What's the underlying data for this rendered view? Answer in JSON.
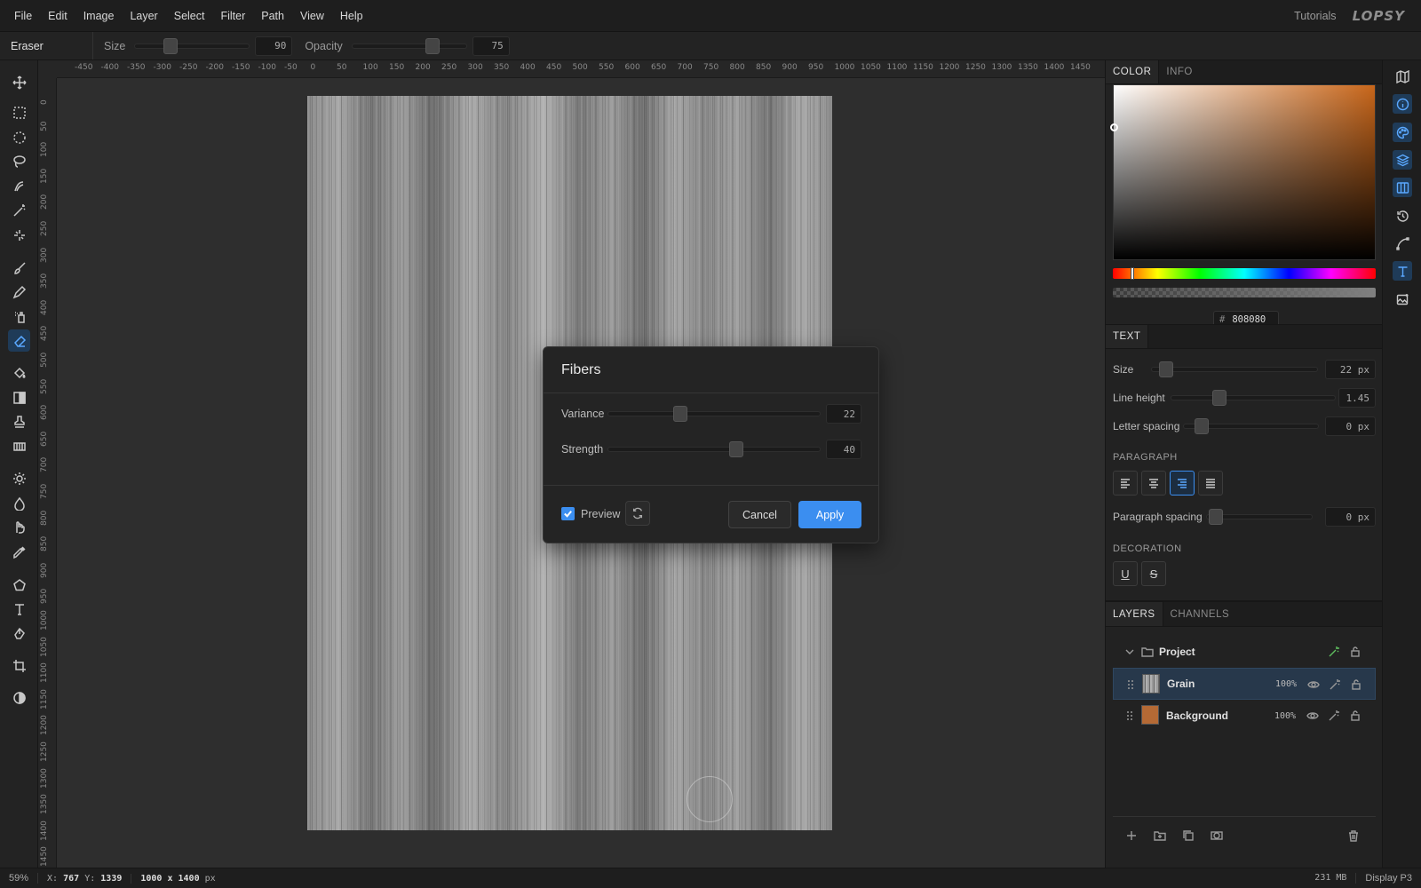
{
  "menu": {
    "items": [
      "File",
      "Edit",
      "Image",
      "Layer",
      "Select",
      "Filter",
      "Path",
      "View",
      "Help"
    ],
    "tutorials": "Tutorials",
    "logo": "LOPSY"
  },
  "options": {
    "tool": "Eraser",
    "size_label": "Size",
    "size_value": "90",
    "opacity_label": "Opacity",
    "opacity_value": "75"
  },
  "ruler": {
    "top": [
      "-450",
      "-400",
      "-350",
      "-300",
      "-250",
      "-200",
      "-150",
      "-100",
      "-50",
      "0",
      "50",
      "100",
      "150",
      "200",
      "250",
      "300",
      "350",
      "400",
      "450",
      "500",
      "550",
      "600",
      "650",
      "700",
      "750",
      "800",
      "850",
      "900",
      "950",
      "1000",
      "1050",
      "1100",
      "1150",
      "1200",
      "1250",
      "1300",
      "1350",
      "1400",
      "1450"
    ],
    "left": [
      "0",
      "50",
      "100",
      "150",
      "200",
      "250",
      "300",
      "350",
      "400",
      "450",
      "500",
      "550",
      "600",
      "650",
      "700",
      "750",
      "800",
      "850",
      "900",
      "950",
      "1000",
      "1050",
      "1100",
      "1150",
      "1200",
      "1250",
      "1300",
      "1350",
      "1400",
      "1450"
    ]
  },
  "dialog": {
    "title": "Fibers",
    "variance_label": "Variance",
    "variance_value": "22",
    "strength_label": "Strength",
    "strength_value": "40",
    "preview_label": "Preview",
    "preview_checked": true,
    "cancel": "Cancel",
    "apply": "Apply"
  },
  "color_panel": {
    "tabs": [
      "COLOR",
      "INFO"
    ],
    "hex_prefix": "#",
    "hex": "808080",
    "base_hue": "#c8661a"
  },
  "text_panel": {
    "tab": "TEXT",
    "size_label": "Size",
    "size_value": "22 px",
    "line_height_label": "Line height",
    "line_height_value": "1.45",
    "letter_spacing_label": "Letter spacing",
    "letter_spacing_value": "0 px",
    "paragraph_heading": "PARAGRAPH",
    "paragraph_spacing_label": "Paragraph spacing",
    "paragraph_spacing_value": "0 px",
    "decoration_heading": "DECORATION",
    "underline_glyph": "U",
    "strike_glyph": "S"
  },
  "layers_panel": {
    "tabs": [
      "LAYERS",
      "CHANNELS"
    ],
    "group": "Project",
    "layers": [
      {
        "name": "Grain",
        "opacity": "100%",
        "selected": true
      },
      {
        "name": "Background",
        "opacity": "100%",
        "selected": false
      }
    ]
  },
  "status": {
    "zoom": "59%",
    "x_label": "X:",
    "x": "767",
    "y_label": "Y:",
    "y": "1339",
    "size": "1000 x 1400",
    "unit": "px",
    "memory": "231 MB",
    "display": "Display P3"
  },
  "colors": {
    "accent": "#3b8ef0",
    "background_layer": "#b56a35"
  }
}
